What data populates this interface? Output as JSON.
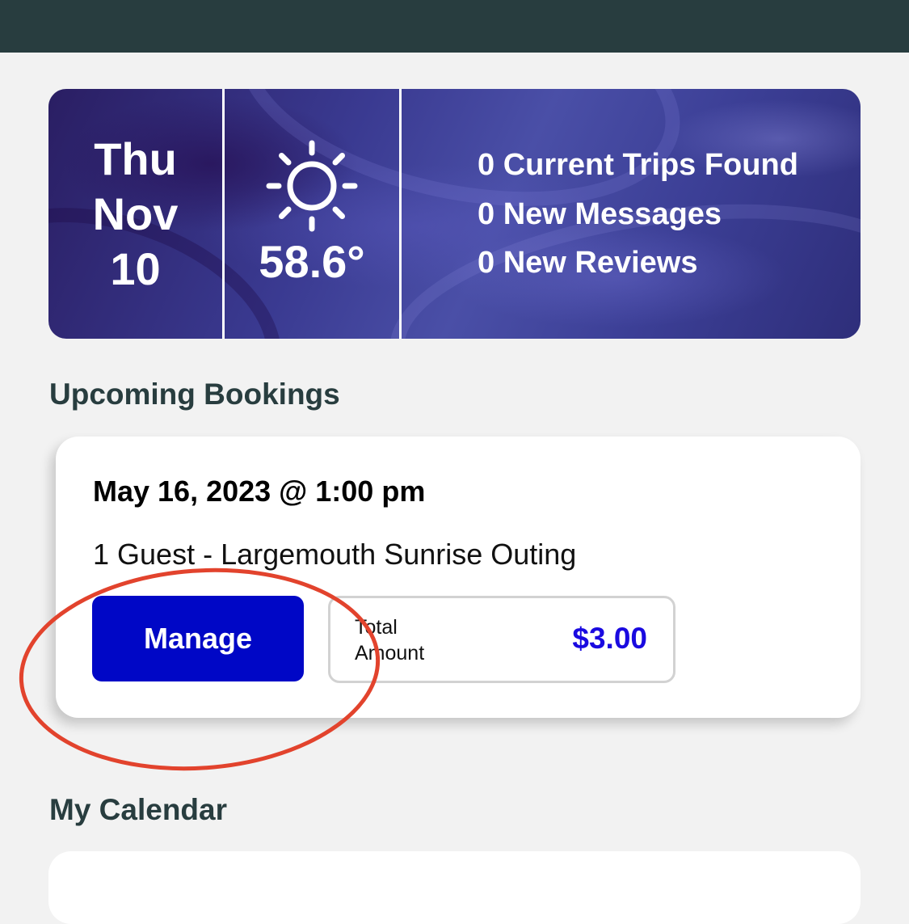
{
  "stats": {
    "date": {
      "weekday": "Thu",
      "month": "Nov",
      "day": "10"
    },
    "weather": {
      "icon": "sun-icon",
      "temperature": "58.6°"
    },
    "summary": {
      "trips": "0 Current Trips Found",
      "messages": "0 New Messages",
      "reviews": "0 New Reviews"
    }
  },
  "sections": {
    "upcoming_title": "Upcoming Bookings",
    "calendar_title": "My Calendar"
  },
  "booking": {
    "datetime": "May 16, 2023 @ 1:00 pm",
    "description": "1 Guest - Largemouth Sunrise Outing",
    "manage_label": "Manage",
    "total_label": "Total Amount",
    "total_value": "$3.00"
  },
  "colors": {
    "header": "#283d3f",
    "manage_button": "#0007c6",
    "price": "#1a0ae0",
    "annotation": "#e2432d"
  }
}
